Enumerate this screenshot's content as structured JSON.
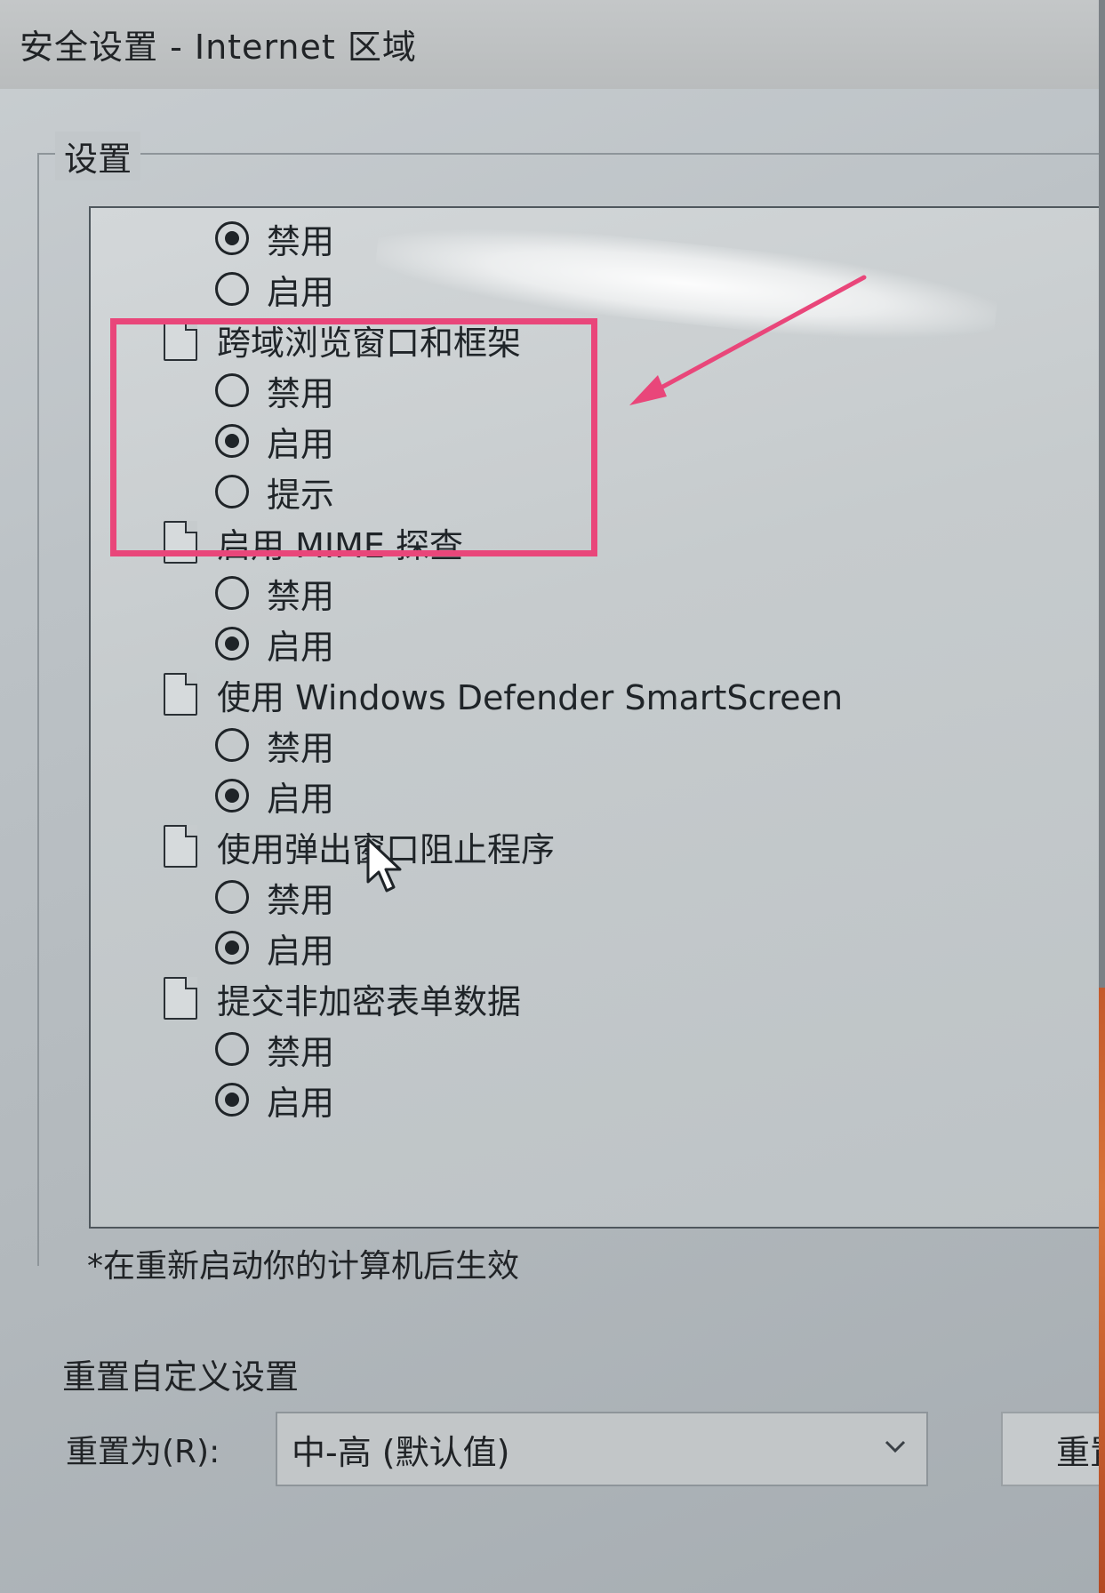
{
  "window": {
    "title": "安全设置 - Internet 区域"
  },
  "settings_group": {
    "label": "设置",
    "items": [
      {
        "type": "option",
        "label": "禁用",
        "checked": true
      },
      {
        "type": "option",
        "label": "启用",
        "checked": false
      },
      {
        "type": "category",
        "label": "跨域浏览窗口和框架",
        "icon": "document-icon"
      },
      {
        "type": "option",
        "label": "禁用",
        "checked": false
      },
      {
        "type": "option",
        "label": "启用",
        "checked": true
      },
      {
        "type": "option",
        "label": "提示",
        "checked": false
      },
      {
        "type": "category",
        "label": "启用 MIME 探查",
        "icon": "document-icon"
      },
      {
        "type": "option",
        "label": "禁用",
        "checked": false
      },
      {
        "type": "option",
        "label": "启用",
        "checked": true
      },
      {
        "type": "category",
        "label": "使用 Windows Defender SmartScreen",
        "icon": "document-icon"
      },
      {
        "type": "option",
        "label": "禁用",
        "checked": false
      },
      {
        "type": "option",
        "label": "启用",
        "checked": true
      },
      {
        "type": "category",
        "label": "使用弹出窗口阻止程序",
        "icon": "document-icon"
      },
      {
        "type": "option",
        "label": "禁用",
        "checked": false
      },
      {
        "type": "option",
        "label": "启用",
        "checked": true
      },
      {
        "type": "category",
        "label": "提交非加密表单数据",
        "icon": "document-icon"
      },
      {
        "type": "option",
        "label": "禁用",
        "checked": false
      },
      {
        "type": "option",
        "label": "启用",
        "checked": true
      }
    ]
  },
  "note": "*在重新启动你的计算机后生效",
  "reset": {
    "heading": "重置自定义设置",
    "label": "重置为(R):",
    "selected": "中-高 (默认值)",
    "button": "重置"
  },
  "annotation": {
    "highlight_color": "#e9467a",
    "arrow_color": "#e9467a"
  }
}
